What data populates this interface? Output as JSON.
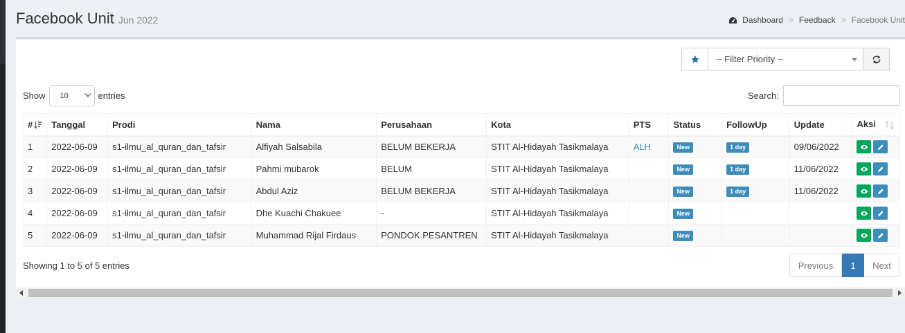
{
  "header": {
    "title": "Facebook Unit",
    "subtitle": "Jun 2022"
  },
  "breadcrumb": {
    "items": [
      "Dashboard",
      "Feedback",
      "Facebook Unit"
    ],
    "icon": "dashboard-icon"
  },
  "filter": {
    "placeholder": "-- Filter Priority --",
    "star_icon": "star-icon",
    "refresh_icon": "refresh-icon"
  },
  "table_controls": {
    "show_label": "Show",
    "length_value": "10",
    "entries_label": "entries",
    "search_label": "Search:",
    "search_value": ""
  },
  "table": {
    "columns": [
      "#",
      "Tanggal",
      "Prodi",
      "Nama",
      "Perusahaan",
      "Kota",
      "PTS",
      "Status",
      "FollowUp",
      "Update",
      "Aksi"
    ],
    "rows": [
      {
        "no": "1",
        "tanggal": "2022-06-09",
        "prodi": "s1-ilmu_al_quran_dan_tafsir",
        "nama": "Alfiyah Salsabila",
        "perusahaan": "BELUM BEKERJA",
        "kota": "STIT Al-Hidayah Tasikmalaya",
        "pts": "ALH",
        "status": "New",
        "followup": "1 day",
        "update": "09/06/2022"
      },
      {
        "no": "2",
        "tanggal": "2022-06-09",
        "prodi": "s1-ilmu_al_quran_dan_tafsir",
        "nama": "Pahmi mubarok",
        "perusahaan": "BELUM",
        "kota": "STIT Al-Hidayah Tasikmalaya",
        "pts": "",
        "status": "New",
        "followup": "1 day",
        "update": "11/06/2022"
      },
      {
        "no": "3",
        "tanggal": "2022-06-09",
        "prodi": "s1-ilmu_al_quran_dan_tafsir",
        "nama": "Abdul Aziz",
        "perusahaan": "BELUM BEKERJA",
        "kota": "STIT Al-Hidayah Tasikmalaya",
        "pts": "",
        "status": "New",
        "followup": "1 day",
        "update": "11/06/2022"
      },
      {
        "no": "4",
        "tanggal": "2022-06-09",
        "prodi": "s1-ilmu_al_quran_dan_tafsir",
        "nama": "Dhe Kuachi Chakuee",
        "perusahaan": "-",
        "kota": "STIT Al-Hidayah Tasikmalaya",
        "pts": "",
        "status": "New",
        "followup": "",
        "update": ""
      },
      {
        "no": "5",
        "tanggal": "2022-06-09",
        "prodi": "s1-ilmu_al_quran_dan_tafsir",
        "nama": "Muhammad Rijal Firdaus",
        "perusahaan": "PONDOK PESANTREN",
        "kota": "STIT Al-Hidayah Tasikmalaya",
        "pts": "",
        "status": "New",
        "followup": "",
        "update": ""
      }
    ],
    "action_icons": [
      "eye-icon",
      "pencil-icon"
    ]
  },
  "footer": {
    "info": "Showing 1 to 5 of 5 entries",
    "prev": "Previous",
    "current_page": "1",
    "next": "Next"
  },
  "colors": {
    "primary": "#3c8dbc",
    "success": "#00a65a",
    "page_bg": "#ecf0f5",
    "pagination_active": "#337ab7"
  }
}
